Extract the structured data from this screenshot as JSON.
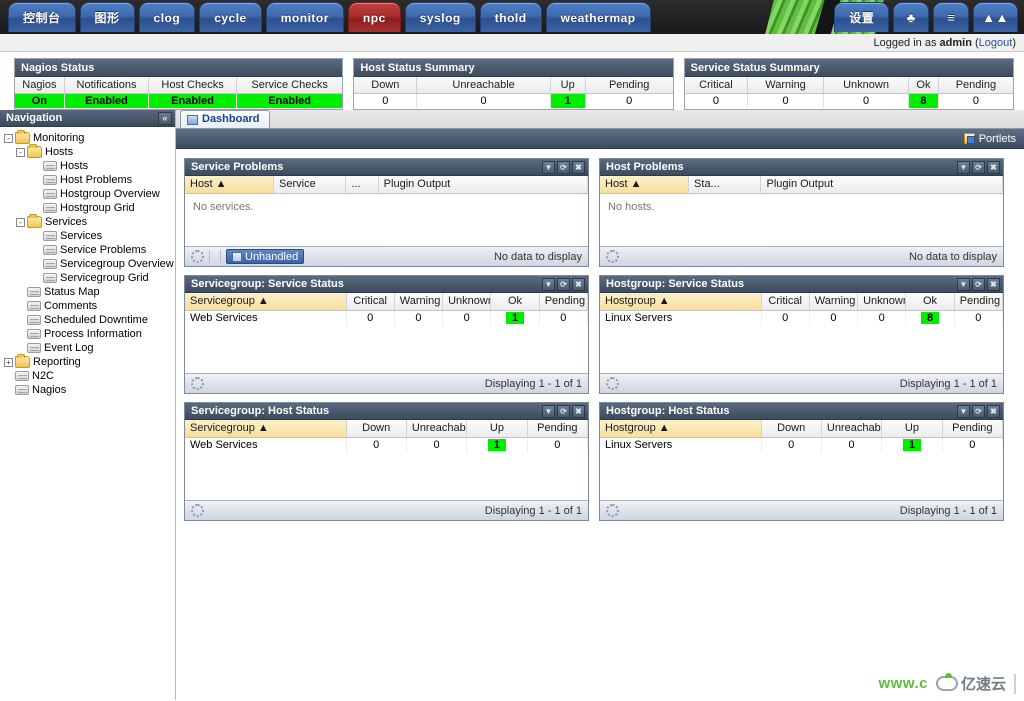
{
  "topbar": {
    "tabs_left": [
      {
        "label": "控制台",
        "style": "blue"
      },
      {
        "label": "图形",
        "style": "blue"
      },
      {
        "label": "clog",
        "style": "blue"
      },
      {
        "label": "cycle",
        "style": "blue"
      },
      {
        "label": "monitor",
        "style": "blue"
      },
      {
        "label": "npc",
        "style": "red"
      },
      {
        "label": "syslog",
        "style": "blue"
      },
      {
        "label": "thold",
        "style": "blue"
      },
      {
        "label": "weathermap",
        "style": "blue"
      }
    ],
    "tabs_right": [
      {
        "label": "设置",
        "icon": ""
      },
      {
        "label": "",
        "icon": "tree-icon"
      },
      {
        "label": "",
        "icon": "list-icon"
      },
      {
        "label": "",
        "icon": "mountain-icon"
      }
    ]
  },
  "loginbar": {
    "prefix": "Logged in as ",
    "user": "admin",
    "open_paren": " (",
    "logout": "Logout",
    "close_paren": ")"
  },
  "summaries": [
    {
      "title": "Nagios Status",
      "headers": [
        "Nagios",
        "Notifications",
        "Host Checks",
        "Service Checks"
      ],
      "values": [
        "On",
        "Enabled",
        "Enabled",
        "Enabled"
      ],
      "highlight": [
        true,
        true,
        true,
        true
      ]
    },
    {
      "title": "Host Status Summary",
      "headers": [
        "Down",
        "Unreachable",
        "Up",
        "Pending"
      ],
      "values": [
        "0",
        "0",
        "1",
        "0"
      ],
      "highlight": [
        false,
        false,
        true,
        false
      ]
    },
    {
      "title": "Service Status Summary",
      "headers": [
        "Critical",
        "Warning",
        "Unknown",
        "Ok",
        "Pending"
      ],
      "values": [
        "0",
        "0",
        "0",
        "8",
        "0"
      ],
      "highlight": [
        false,
        false,
        false,
        true,
        false
      ]
    }
  ],
  "sidebar": {
    "title": "Navigation",
    "collapse_glyph": "«",
    "items": [
      {
        "label": "Monitoring",
        "type": "folder",
        "toggle": "-",
        "indent": 1
      },
      {
        "label": "Hosts",
        "type": "folder",
        "toggle": "-",
        "indent": 2
      },
      {
        "label": "Hosts",
        "type": "leaf",
        "indent": 3
      },
      {
        "label": "Host Problems",
        "type": "leaf",
        "indent": 3
      },
      {
        "label": "Hostgroup Overview",
        "type": "leaf",
        "indent": 3
      },
      {
        "label": "Hostgroup Grid",
        "type": "leaf",
        "indent": 3
      },
      {
        "label": "Services",
        "type": "folder",
        "toggle": "-",
        "indent": 2
      },
      {
        "label": "Services",
        "type": "leaf",
        "indent": 3
      },
      {
        "label": "Service Problems",
        "type": "leaf",
        "indent": 3
      },
      {
        "label": "Servicegroup Overview",
        "type": "leaf",
        "indent": 3
      },
      {
        "label": "Servicegroup Grid",
        "type": "leaf",
        "indent": 3
      },
      {
        "label": "Status Map",
        "type": "leaf",
        "indent": 2
      },
      {
        "label": "Comments",
        "type": "leaf",
        "indent": 2
      },
      {
        "label": "Scheduled Downtime",
        "type": "leaf",
        "indent": 2
      },
      {
        "label": "Process Information",
        "type": "leaf",
        "indent": 2
      },
      {
        "label": "Event Log",
        "type": "leaf",
        "indent": 2
      },
      {
        "label": "Reporting",
        "type": "folder",
        "toggle": "+",
        "indent": 1
      },
      {
        "label": "N2C",
        "type": "leaf",
        "indent": 1
      },
      {
        "label": "Nagios",
        "type": "leaf",
        "indent": 1
      }
    ]
  },
  "content": {
    "dashboard_tab": "Dashboard",
    "portlets_label": "Portlets"
  },
  "panels": [
    {
      "title": "Service Problems",
      "headers": [
        "Host",
        "Service",
        "...",
        "Plugin Output"
      ],
      "sorted_col": 0,
      "sort_glyph": "▲",
      "empty_text": "No services.",
      "footer_right": "No data to display",
      "unhandled_label": "Unhandled",
      "has_unhandled": true
    },
    {
      "title": "Host Problems",
      "headers": [
        "Host",
        "Sta...",
        "Plugin Output"
      ],
      "sorted_col": 0,
      "sort_glyph": "▲",
      "empty_text": "No hosts.",
      "footer_right": "No data to display",
      "has_unhandled": false
    },
    {
      "title": "Servicegroup: Service Status",
      "headers": [
        "Servicegroup",
        "Critical",
        "Warning",
        "Unknown",
        "Ok",
        "Pending"
      ],
      "sorted_col": 0,
      "sort_glyph": "▲",
      "rows": [
        {
          "name": "Web Services",
          "values": [
            "0",
            "0",
            "0",
            "1",
            "0"
          ],
          "highlight_index": 3
        }
      ],
      "footer_right": "Displaying 1 - 1 of 1",
      "has_unhandled": false
    },
    {
      "title": "Hostgroup: Service Status",
      "headers": [
        "Hostgroup",
        "Critical",
        "Warning",
        "Unknown",
        "Ok",
        "Pending"
      ],
      "sorted_col": 0,
      "sort_glyph": "▲",
      "rows": [
        {
          "name": "Linux Servers",
          "values": [
            "0",
            "0",
            "0",
            "8",
            "0"
          ],
          "highlight_index": 3
        }
      ],
      "footer_right": "Displaying 1 - 1 of 1",
      "has_unhandled": false
    },
    {
      "title": "Servicegroup: Host Status",
      "headers": [
        "Servicegroup",
        "Down",
        "Unreachable",
        "Up",
        "Pending"
      ],
      "sorted_col": 0,
      "sort_glyph": "▲",
      "rows": [
        {
          "name": "Web Services",
          "values": [
            "0",
            "0",
            "1",
            "0"
          ],
          "highlight_index": 2
        }
      ],
      "footer_right": "Displaying 1 - 1 of 1",
      "has_unhandled": false
    },
    {
      "title": "Hostgroup: Host Status",
      "headers": [
        "Hostgroup",
        "Down",
        "Unreachable",
        "Up",
        "Pending"
      ],
      "sorted_col": 0,
      "sort_glyph": "▲",
      "rows": [
        {
          "name": "Linux Servers",
          "values": [
            "0",
            "0",
            "1",
            "0"
          ],
          "highlight_index": 2
        }
      ],
      "footer_right": "Displaying 1 - 1 of 1",
      "has_unhandled": false
    }
  ],
  "watermark": {
    "text": "www.c",
    "logo_text": "亿速云"
  },
  "colors": {
    "ok_green": "#00ee00",
    "header_blue": "#3d4c5e",
    "tab_blue": "#3f69ad",
    "tab_red": "#a82c2c",
    "sorted_amber": "#f7dfa1"
  }
}
